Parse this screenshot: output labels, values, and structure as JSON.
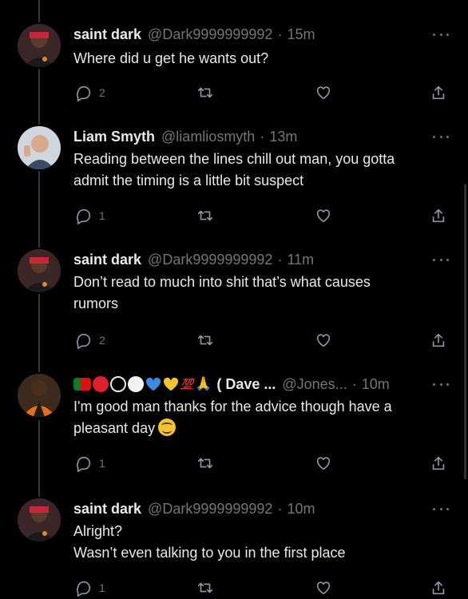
{
  "colors": {
    "background": "#000000",
    "text": "#e7e9ea",
    "muted": "#71767b",
    "thread_line": "#333639"
  },
  "icons": {
    "reply": "reply-icon",
    "retweet": "retweet-icon",
    "like": "heart-icon",
    "share": "share-icon",
    "more": "more-icon"
  },
  "tweets": [
    {
      "name": "saint dark",
      "handle": "@Dark9999999992",
      "time": "15m",
      "lines": [
        "Where did u get he wants out?"
      ],
      "reply_count": "2"
    },
    {
      "name": "Liam Smyth",
      "handle": "@liamliosmyth",
      "time": "13m",
      "lines": [
        "Reading between the lines chill out man, you gotta",
        "admit the timing is a little bit suspect"
      ],
      "reply_count": "1"
    },
    {
      "name": "saint dark",
      "handle": "@Dark9999999992",
      "time": "11m",
      "lines": [
        "Don’t read to much into shit that’s what causes",
        "rumors"
      ],
      "reply_count": "2"
    },
    {
      "name": "( Dave ...",
      "name_emoji_100": "💯",
      "name_emoji_pray": "🙏",
      "handle": "@Jones...",
      "time": "10m",
      "lines": [
        "I'm good man thanks for the advice though have a",
        "pleasant day"
      ],
      "reply_count": "1"
    },
    {
      "name": "saint dark",
      "handle": "@Dark9999999992",
      "time": "10m",
      "lines": [
        "Alright?",
        "Wasn’t even talking to you in the first place"
      ],
      "reply_count": "1"
    }
  ],
  "separator": "·"
}
